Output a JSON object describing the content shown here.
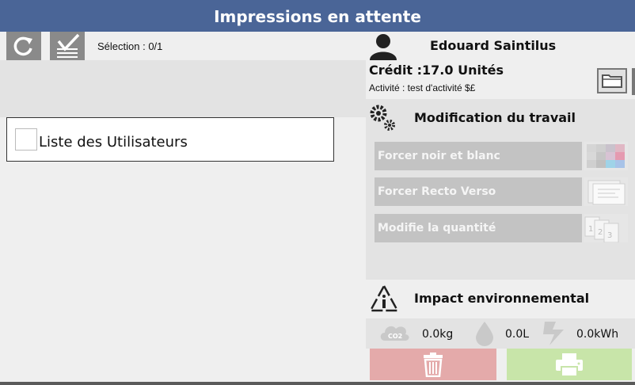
{
  "header": {
    "title": "Impressions en attente"
  },
  "toolbar": {
    "selection_text": "Sélection : 0/1"
  },
  "user_list": {
    "label": "Liste des Utilisateurs"
  },
  "account": {
    "name": "Edouard Saintilus",
    "credit": "Crédit :17.0 Unités",
    "activity": "Activité : test d'activité $£"
  },
  "modification": {
    "title": "Modification du travail",
    "options": [
      {
        "label": "Forcer noir et blanc",
        "icon": "color-palette-icon"
      },
      {
        "label": "Forcer Recto Verso",
        "icon": "duplex-pages-icon"
      },
      {
        "label": "Modifie la quantité",
        "icon": "quantity-pages-icon"
      }
    ]
  },
  "environment": {
    "title": "Impact environnemental",
    "co2": "0.0kg",
    "water": "0.0L",
    "energy": "0.0kWh"
  },
  "colors": {
    "header": "#4a6597",
    "delete": "#e4aaaa",
    "print": "#c8e5a9"
  }
}
